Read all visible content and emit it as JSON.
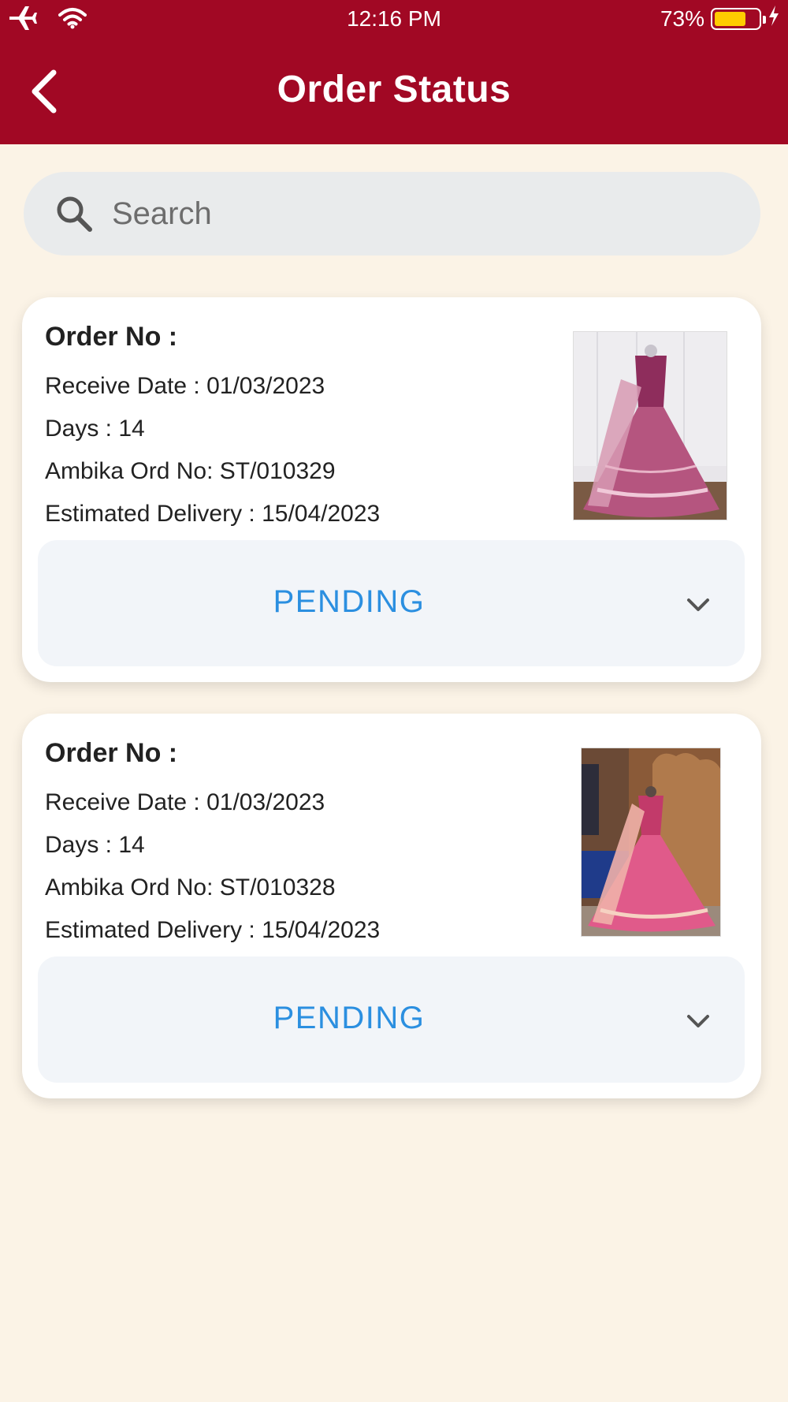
{
  "status_bar": {
    "time": "12:16 PM",
    "battery": "73%",
    "battery_level": 0.73,
    "icons": [
      "airplane-icon",
      "wifi-icon",
      "charging-bolt-icon"
    ]
  },
  "header": {
    "title": "Order Status",
    "back_icon": "chevron-left-icon",
    "background": "#a10824"
  },
  "search": {
    "placeholder": "Search",
    "value": ""
  },
  "colors": {
    "background": "#fbf3e6",
    "status_text": "#2b8fe0"
  },
  "orders": [
    {
      "order_no_label": "Order No :",
      "receive_date": "Receive Date : 01/03/2023",
      "days": "Days : 14",
      "ambika_ord_no": "Ambika Ord No: ST/010329",
      "estimated_delivery": "Estimated Delivery : 15/04/2023",
      "status": "PENDING",
      "image": "lehenga-photo-purple"
    },
    {
      "order_no_label": "Order No :",
      "receive_date": "Receive Date : 01/03/2023",
      "days": "Days : 14",
      "ambika_ord_no": "Ambika Ord No: ST/010328",
      "estimated_delivery": "Estimated Delivery : 15/04/2023",
      "status": "PENDING",
      "image": "lehenga-photo-pink"
    }
  ]
}
